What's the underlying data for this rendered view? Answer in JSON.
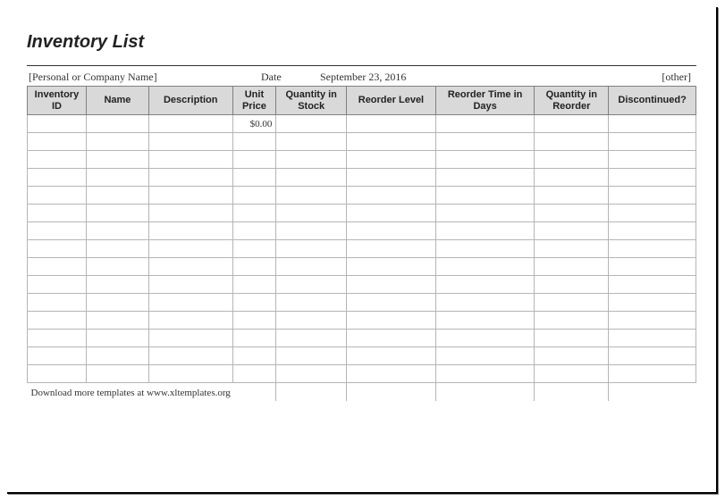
{
  "title": "Inventory List",
  "info": {
    "company": "[Personal or Company Name]",
    "date_label": "Date",
    "date_value": "September 23, 2016",
    "other": "[other]"
  },
  "columns": [
    "Inventory ID",
    "Name",
    "Description",
    "Unit Price",
    "Quantity in Stock",
    "Reorder Level",
    "Reorder Time in Days",
    "Quantity in Reorder",
    "Discontinued?"
  ],
  "rows": [
    {
      "id": "",
      "name": "",
      "description": "",
      "unit_price": "$0.00",
      "qty_stock": "",
      "reorder_level": "",
      "reorder_time": "",
      "qty_reorder": "",
      "discontinued": ""
    },
    {
      "id": "",
      "name": "",
      "description": "",
      "unit_price": "",
      "qty_stock": "",
      "reorder_level": "",
      "reorder_time": "",
      "qty_reorder": "",
      "discontinued": ""
    },
    {
      "id": "",
      "name": "",
      "description": "",
      "unit_price": "",
      "qty_stock": "",
      "reorder_level": "",
      "reorder_time": "",
      "qty_reorder": "",
      "discontinued": ""
    },
    {
      "id": "",
      "name": "",
      "description": "",
      "unit_price": "",
      "qty_stock": "",
      "reorder_level": "",
      "reorder_time": "",
      "qty_reorder": "",
      "discontinued": ""
    },
    {
      "id": "",
      "name": "",
      "description": "",
      "unit_price": "",
      "qty_stock": "",
      "reorder_level": "",
      "reorder_time": "",
      "qty_reorder": "",
      "discontinued": ""
    },
    {
      "id": "",
      "name": "",
      "description": "",
      "unit_price": "",
      "qty_stock": "",
      "reorder_level": "",
      "reorder_time": "",
      "qty_reorder": "",
      "discontinued": ""
    },
    {
      "id": "",
      "name": "",
      "description": "",
      "unit_price": "",
      "qty_stock": "",
      "reorder_level": "",
      "reorder_time": "",
      "qty_reorder": "",
      "discontinued": ""
    },
    {
      "id": "",
      "name": "",
      "description": "",
      "unit_price": "",
      "qty_stock": "",
      "reorder_level": "",
      "reorder_time": "",
      "qty_reorder": "",
      "discontinued": ""
    },
    {
      "id": "",
      "name": "",
      "description": "",
      "unit_price": "",
      "qty_stock": "",
      "reorder_level": "",
      "reorder_time": "",
      "qty_reorder": "",
      "discontinued": ""
    },
    {
      "id": "",
      "name": "",
      "description": "",
      "unit_price": "",
      "qty_stock": "",
      "reorder_level": "",
      "reorder_time": "",
      "qty_reorder": "",
      "discontinued": ""
    },
    {
      "id": "",
      "name": "",
      "description": "",
      "unit_price": "",
      "qty_stock": "",
      "reorder_level": "",
      "reorder_time": "",
      "qty_reorder": "",
      "discontinued": ""
    },
    {
      "id": "",
      "name": "",
      "description": "",
      "unit_price": "",
      "qty_stock": "",
      "reorder_level": "",
      "reorder_time": "",
      "qty_reorder": "",
      "discontinued": ""
    },
    {
      "id": "",
      "name": "",
      "description": "",
      "unit_price": "",
      "qty_stock": "",
      "reorder_level": "",
      "reorder_time": "",
      "qty_reorder": "",
      "discontinued": ""
    },
    {
      "id": "",
      "name": "",
      "description": "",
      "unit_price": "",
      "qty_stock": "",
      "reorder_level": "",
      "reorder_time": "",
      "qty_reorder": "",
      "discontinued": ""
    },
    {
      "id": "",
      "name": "",
      "description": "",
      "unit_price": "",
      "qty_stock": "",
      "reorder_level": "",
      "reorder_time": "",
      "qty_reorder": "",
      "discontinued": ""
    }
  ],
  "footer": "Download more templates at www.xltemplates.org"
}
